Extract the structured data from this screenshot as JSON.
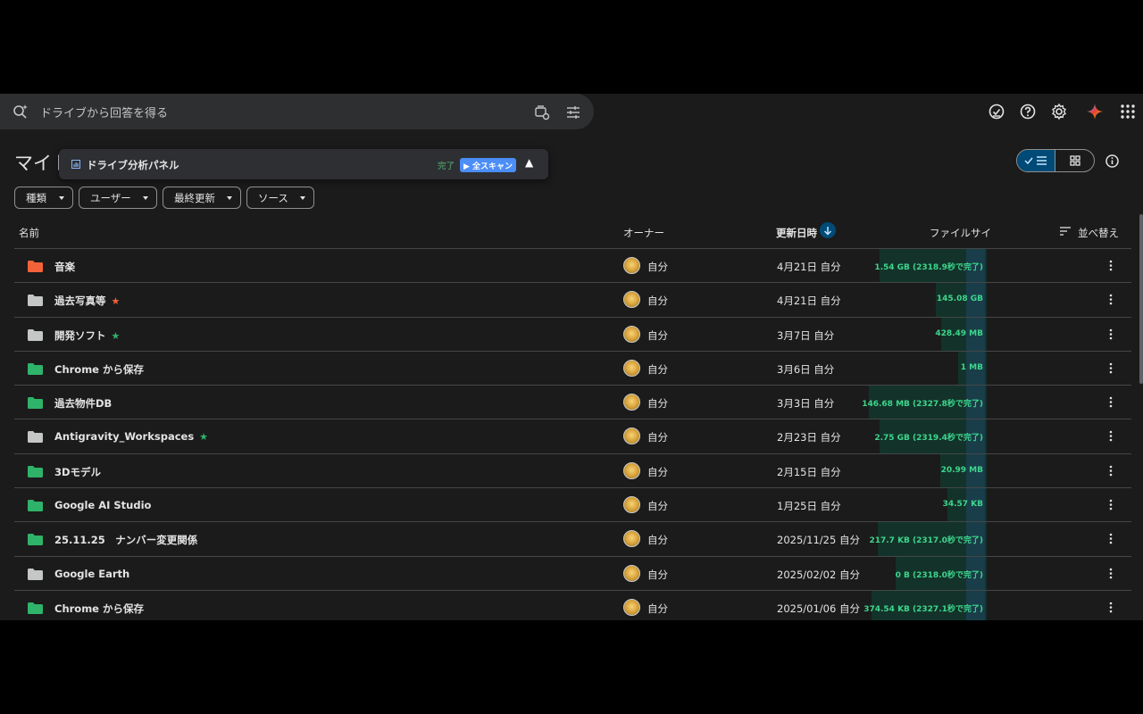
{
  "search": {
    "placeholder": "ドライブから回答を得る"
  },
  "page_title": "マイト",
  "panel": {
    "title": "ドライブ分析パネル",
    "status": "完了",
    "scan_button": "▶ 全スキャン",
    "collapse": "▲"
  },
  "filters": [
    {
      "label": "種類"
    },
    {
      "label": "ユーザー"
    },
    {
      "label": "最終更新"
    },
    {
      "label": "ソース"
    }
  ],
  "columns": {
    "name": "名前",
    "owner": "オーナー",
    "modified": "更新日時",
    "size": "ファイルサイ",
    "sort": "並べ替え"
  },
  "colors": {
    "folder_orange": "#f4623a",
    "folder_grey": "#c4c7c5",
    "folder_green": "#2fb36a",
    "star_red": "#f4623a",
    "star_green": "#2fb36a",
    "size_text": "#3dd68c"
  },
  "rows": [
    {
      "name": "音楽",
      "folder_color": "#f4623a",
      "star": "",
      "star_color": "",
      "owner": "自分",
      "modified": "4月21日 自分",
      "size": "1.54 GB (2318.9秒で完了)"
    },
    {
      "name": "過去写真等",
      "folder_color": "#c4c7c5",
      "star": "★",
      "star_color": "#f4623a",
      "owner": "自分",
      "modified": "4月21日 自分",
      "size": "145.08 GB"
    },
    {
      "name": "開発ソフト",
      "folder_color": "#c4c7c5",
      "star": "★",
      "star_color": "#2fb36a",
      "owner": "自分",
      "modified": "3月7日 自分",
      "size": "428.49 MB"
    },
    {
      "name": "Chrome から保存",
      "folder_color": "#2fb36a",
      "star": "",
      "star_color": "",
      "owner": "自分",
      "modified": "3月6日 自分",
      "size": "1 MB"
    },
    {
      "name": "過去物件DB",
      "folder_color": "#2fb36a",
      "star": "",
      "star_color": "",
      "owner": "自分",
      "modified": "3月3日 自分",
      "size": "146.68 MB (2327.8秒で完了)"
    },
    {
      "name": "Antigravity_Workspaces",
      "folder_color": "#c4c7c5",
      "star": "★",
      "star_color": "#2fb36a",
      "owner": "自分",
      "modified": "2月23日 自分",
      "size": "2.75 GB (2319.4秒で完了)"
    },
    {
      "name": "3Dモデル",
      "folder_color": "#2fb36a",
      "star": "",
      "star_color": "",
      "owner": "自分",
      "modified": "2月15日 自分",
      "size": "20.99 MB"
    },
    {
      "name": "Google AI Studio",
      "folder_color": "#2fb36a",
      "star": "",
      "star_color": "",
      "owner": "自分",
      "modified": "1月25日 自分",
      "size": "34.57 KB"
    },
    {
      "name": "25.11.25　ナンバー変更関係",
      "folder_color": "#2fb36a",
      "star": "",
      "star_color": "",
      "owner": "自分",
      "modified": "2025/11/25 自分",
      "size": "217.7 KB (2317.0秒で完了)"
    },
    {
      "name": "Google Earth",
      "folder_color": "#c4c7c5",
      "star": "",
      "star_color": "",
      "owner": "自分",
      "modified": "2025/02/02 自分",
      "size": "0 B (2318.0秒で完了)"
    },
    {
      "name": "Chrome から保存",
      "folder_color": "#2fb36a",
      "star": "",
      "star_color": "",
      "owner": "自分",
      "modified": "2025/01/06 自分",
      "size": "374.54 KB (2327.1秒で完了)"
    }
  ]
}
